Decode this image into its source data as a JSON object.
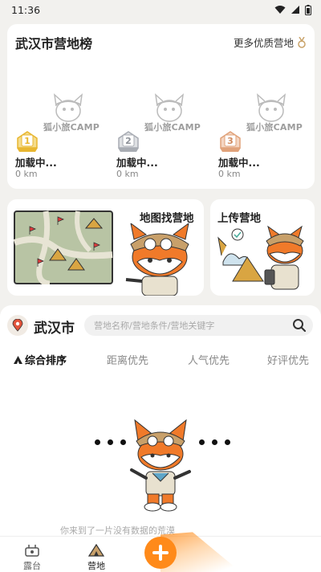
{
  "status_bar": {
    "time": "11:36"
  },
  "ranking": {
    "title": "武汉市营地榜",
    "more_label": "更多优质营地",
    "logo_text": "狐小旅CAMP",
    "items": [
      {
        "rank": "1",
        "name": "加载中...",
        "distance": "0 km",
        "badge_color": "#e8b630"
      },
      {
        "rank": "2",
        "name": "加载中...",
        "distance": "0 km",
        "badge_color": "#a8acb3"
      },
      {
        "rank": "3",
        "name": "加载中...",
        "distance": "0 km",
        "badge_color": "#e0a27a"
      }
    ]
  },
  "features": {
    "map_title": "地图找营地",
    "upload_title": "上传营地"
  },
  "search": {
    "city": "武汉市",
    "placeholder": "营地名称/营地条件/营地关键字"
  },
  "sort_tabs": [
    {
      "label": "综合排序",
      "active": true
    },
    {
      "label": "距离优先",
      "active": false
    },
    {
      "label": "人气优先",
      "active": false
    },
    {
      "label": "好评优先",
      "active": false
    }
  ],
  "empty_state": {
    "text": "你来到了一片没有数据的荒漠"
  },
  "tabbar": {
    "items": [
      {
        "label": "露台",
        "active": false
      },
      {
        "label": "营地",
        "active": true
      }
    ]
  },
  "colors": {
    "accent": "#ff8a1a",
    "fox": "#f07a2a",
    "hat": "#c8a06a"
  }
}
